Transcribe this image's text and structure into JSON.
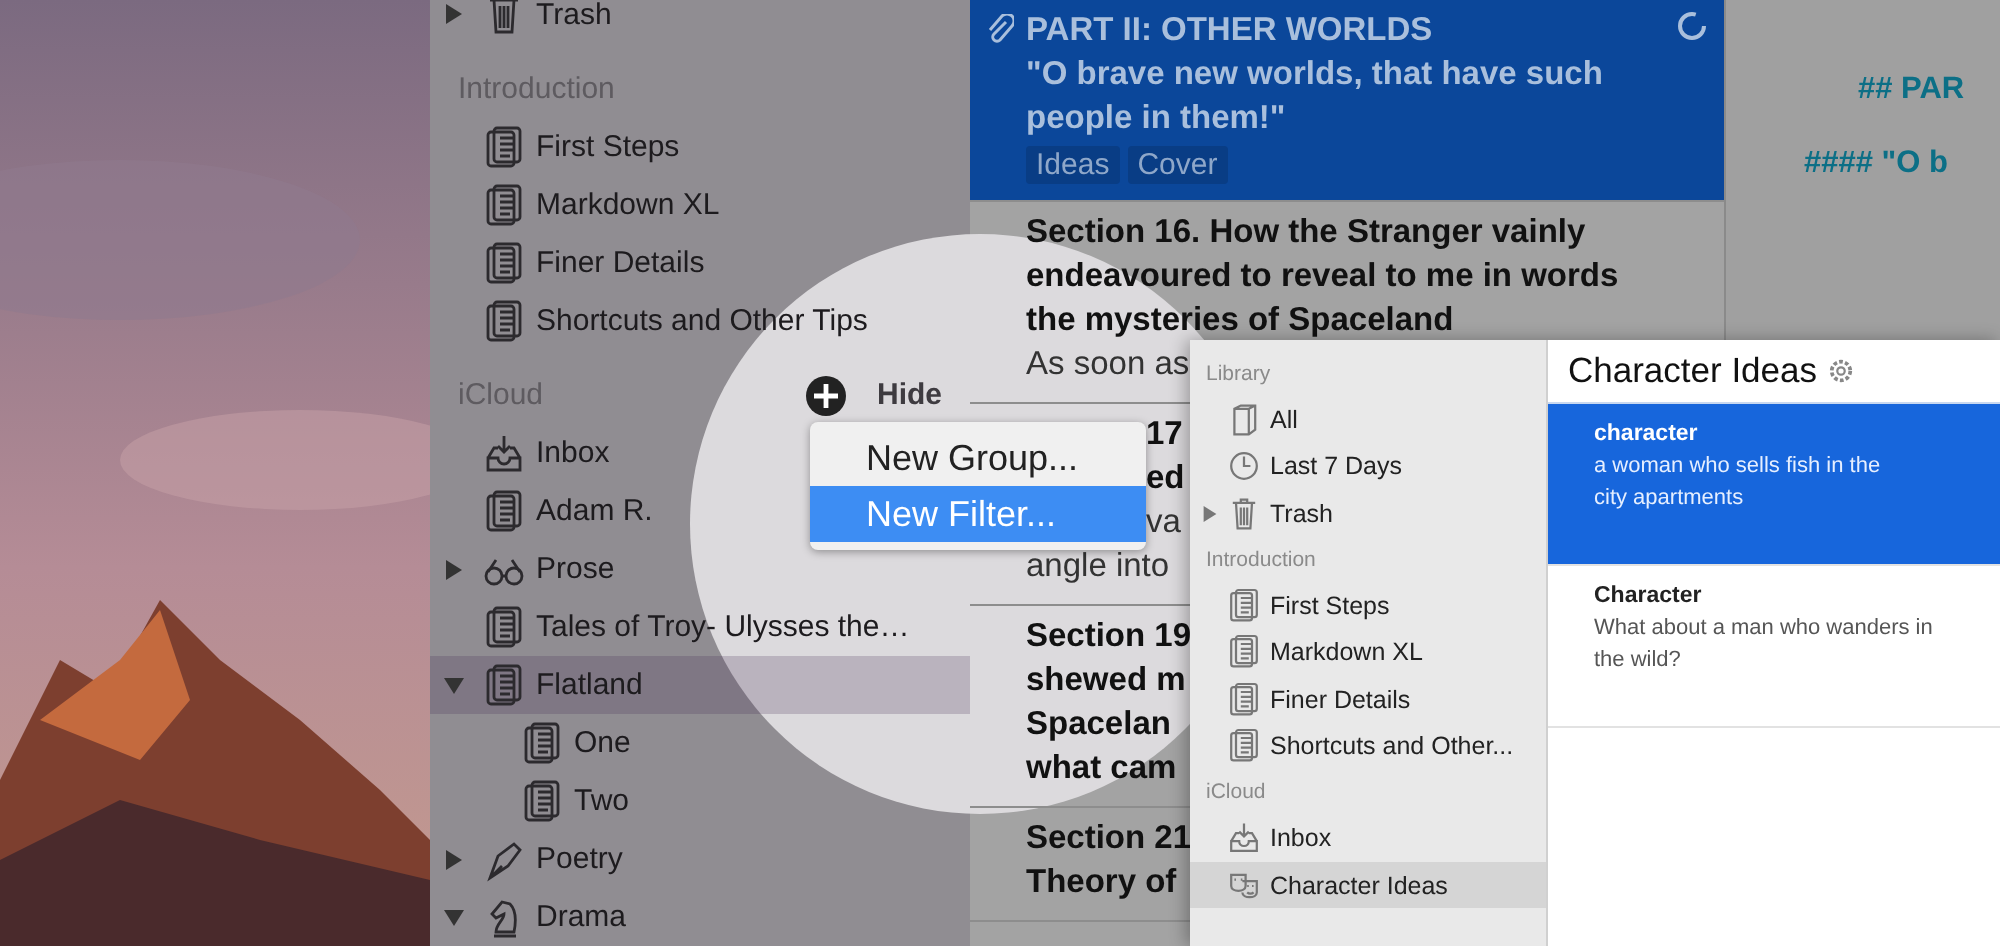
{
  "sidebar": {
    "sections": [
      {
        "items": [
          {
            "label": "Trash",
            "kind": "trash",
            "expanded": false,
            "selected": false
          }
        ]
      },
      {
        "header": "Introduction",
        "items": [
          {
            "label": "First Steps",
            "kind": "document",
            "selected": false
          },
          {
            "label": "Markdown XL",
            "kind": "document",
            "selected": false
          },
          {
            "label": "Finer Details",
            "kind": "document",
            "selected": false
          },
          {
            "label": "Shortcuts and Other Tips",
            "kind": "document",
            "selected": false
          }
        ]
      },
      {
        "header": "iCloud",
        "hide_label": "Hide",
        "items": [
          {
            "label": "Inbox",
            "kind": "inbox",
            "selected": false
          },
          {
            "label": "Adam R.",
            "kind": "document",
            "selected": false
          },
          {
            "label": "Prose",
            "kind": "glasses",
            "expanded": false,
            "selected": false
          },
          {
            "label": "Tales of Troy- Ulysses the…",
            "kind": "document",
            "selected": false
          },
          {
            "label": "Flatland",
            "kind": "document",
            "expanded": true,
            "selected": true,
            "children": [
              {
                "label": "One",
                "kind": "document",
                "selected": false
              },
              {
                "label": "Two",
                "kind": "document",
                "selected": false
              }
            ]
          },
          {
            "label": "Poetry",
            "kind": "pen",
            "expanded": false,
            "selected": false
          },
          {
            "label": "Drama",
            "kind": "knight",
            "expanded": true,
            "selected": false
          }
        ]
      }
    ]
  },
  "add_menu": {
    "items": [
      {
        "label": "New Group...",
        "selected": false
      },
      {
        "label": "New Filter...",
        "selected": true
      }
    ]
  },
  "note_list": {
    "notes": [
      {
        "kind": "plain",
        "selected": true,
        "title_lines": [
          "PART II: OTHER WORLDS",
          "\"O brave new worlds, that have such",
          "people in them!\""
        ],
        "tags": [
          "Ideas",
          "Cover"
        ]
      },
      {
        "kind": "plain",
        "selected": false,
        "title_lines": [
          "Section 16. How the Stranger vainly",
          "endeavoured to reveal to me in words",
          "the mysteries of Spaceland"
        ],
        "body_lines": [
          "As soon as"
        ]
      },
      {
        "kind": "under_menu",
        "selected": false,
        "title_lines": [
          "17",
          "ed"
        ],
        "body_lines": [
          "va",
          "angle into"
        ]
      },
      {
        "kind": "plain",
        "selected": false,
        "title_lines": [
          "Section 19",
          "shewed m",
          "Spacelan",
          "what cam"
        ]
      },
      {
        "kind": "plain",
        "selected": false,
        "title_lines": [
          "Section 21",
          "Theory of"
        ]
      }
    ]
  },
  "editor": {
    "lines": [
      "## PAR",
      "#### \"O b"
    ]
  },
  "inset_window": {
    "sidebar": {
      "sections": [
        {
          "header": "Library",
          "items": [
            {
              "label": "All",
              "kind": "book",
              "selected": false
            },
            {
              "label": "Last 7 Days",
              "kind": "clock",
              "selected": false
            },
            {
              "label": "Trash",
              "kind": "trash",
              "expanded": false,
              "selected": false
            }
          ]
        },
        {
          "header": "Introduction",
          "items": [
            {
              "label": "First Steps",
              "kind": "document",
              "selected": false
            },
            {
              "label": "Markdown XL",
              "kind": "document",
              "selected": false
            },
            {
              "label": "Finer Details",
              "kind": "document",
              "selected": false
            },
            {
              "label": "Shortcuts and Other...",
              "kind": "document",
              "selected": false
            }
          ]
        },
        {
          "header": "iCloud",
          "items": [
            {
              "label": "Inbox",
              "kind": "inbox",
              "selected": false
            },
            {
              "label": "Character Ideas",
              "kind": "mask",
              "selected": true
            }
          ]
        }
      ]
    },
    "list_title": "Character Ideas",
    "notes": [
      {
        "title": "character",
        "body_lines": [
          "a woman who sells fish in the",
          "city apartments"
        ],
        "selected": true
      },
      {
        "title": "Character",
        "body_lines": [
          "What about a man who wanders in",
          "the wild?"
        ],
        "selected": false
      }
    ]
  }
}
